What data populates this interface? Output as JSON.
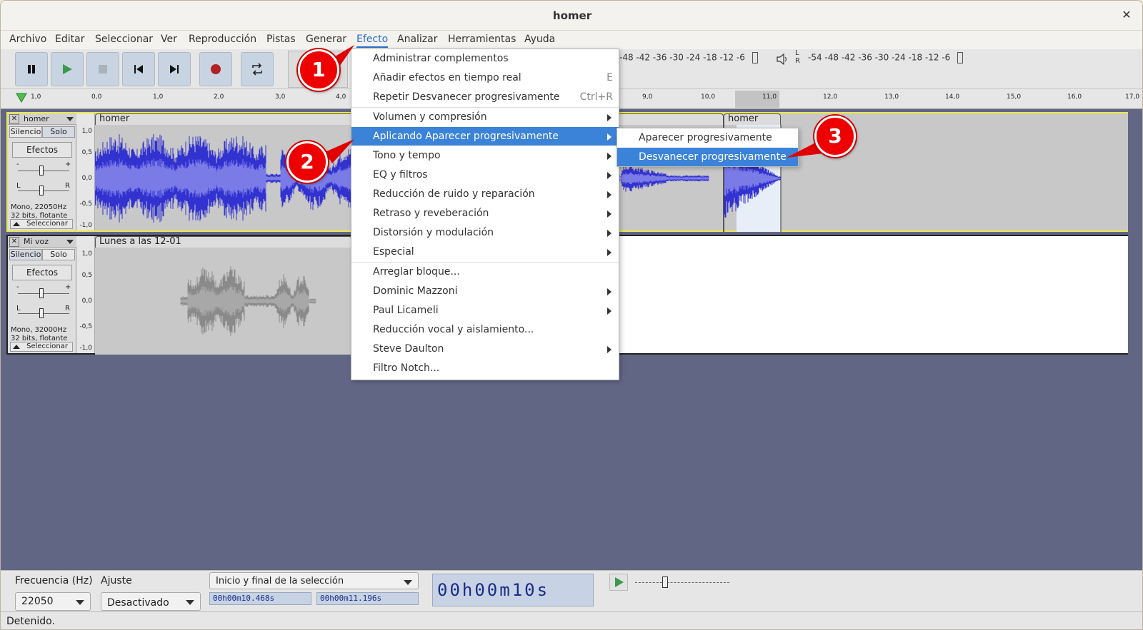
{
  "window": {
    "title": "homer"
  },
  "menubar": [
    "Archivo",
    "Editar",
    "Seleccionar",
    "Ver",
    "Reproducción",
    "Pistas",
    "Generar",
    "Efecto",
    "Analizar",
    "Herramientas",
    "Ayuda"
  ],
  "meters": {
    "record": "-48 -42 -36 -30 -24 -18 -12 -6",
    "play_lr": "L R",
    "play": "-54 -48 -42 -36 -30 -24 -18 -12 -6"
  },
  "ruler": [
    "1,0",
    "0,0",
    "1,0",
    "2,0",
    "3,0",
    "4,0",
    "9,0",
    "10,0",
    "11,0",
    "12,0",
    "13,0",
    "14,0",
    "15,0",
    "16,0",
    "17,0"
  ],
  "tracks": [
    {
      "name": "homer",
      "mute": "Silencio",
      "solo": "Solo",
      "effects": "Efectos",
      "gain_minus": "-",
      "gain_plus": "+",
      "pan_l": "L",
      "pan_r": "R",
      "info1": "Mono, 22050Hz",
      "info2": "32 bits, flotante",
      "select": "Seleccionar",
      "scale": [
        "1,0",
        "0,5",
        "0,0",
        "-0,5",
        "-1,0"
      ],
      "clips": [
        "homer",
        "homer"
      ]
    },
    {
      "name": "Mi voz",
      "mute": "Silencio",
      "solo": "Solo",
      "effects": "Efectos",
      "gain_minus": "-",
      "gain_plus": "+",
      "pan_l": "L",
      "pan_r": "R",
      "info1": "Mono, 32000Hz",
      "info2": "32 bits, flotante",
      "select": "Seleccionar",
      "scale": [
        "1,0",
        "0,5",
        "0,0",
        "-0,5",
        "-1,0"
      ],
      "clips": [
        "Lunes a las 12-01"
      ]
    }
  ],
  "effect_menu": [
    {
      "label": "Administrar complementos"
    },
    {
      "label": "Añadir efectos en tiempo real",
      "shortcut": "E"
    },
    {
      "label": "Repetir Desvanecer progresivamente",
      "shortcut": "Ctrl+R"
    },
    {
      "label": "Volumen y compresión",
      "submenu": true
    },
    {
      "label": "Aplicando Aparecer progresivamente",
      "submenu": true,
      "highlighted": true
    },
    {
      "label": "Tono y tempo",
      "submenu": true
    },
    {
      "label": "EQ y filtros",
      "submenu": true
    },
    {
      "label": "Reducción de ruido y reparación",
      "submenu": true
    },
    {
      "label": "Retraso y reveberación",
      "submenu": true
    },
    {
      "label": "Distorsión y modulación",
      "submenu": true
    },
    {
      "label": "Especial",
      "submenu": true
    },
    {
      "label": "Arreglar bloque..."
    },
    {
      "label": "Dominic Mazzoni",
      "submenu": true
    },
    {
      "label": "Paul Licameli",
      "submenu": true
    },
    {
      "label": "Reducción vocal y aislamiento..."
    },
    {
      "label": "Steve Daulton",
      "submenu": true
    },
    {
      "label": "Filtro Notch..."
    }
  ],
  "submenu": [
    {
      "label": "Aparecer progresivamente"
    },
    {
      "label": "Desvanecer progresivamente",
      "highlighted": true
    }
  ],
  "badges": [
    "1",
    "2",
    "3"
  ],
  "bottom": {
    "rate_label": "Frecuencia (Hz)",
    "rate_value": "22050",
    "snap_label": "Ajuste",
    "snap_value": "Desactivado",
    "selection_mode": "Inicio y final de la selección",
    "sel_start": "00h00m10.468s",
    "sel_end": "00h00m11.196s",
    "big_time": "00h00m10s"
  },
  "status": "Detenido.",
  "colors": {
    "accent": "#3b83d8",
    "badge": "#e00000",
    "track_bg": "#626685",
    "wave_selected": "#3232d0",
    "wave_unselected": "#8a8a8a"
  }
}
